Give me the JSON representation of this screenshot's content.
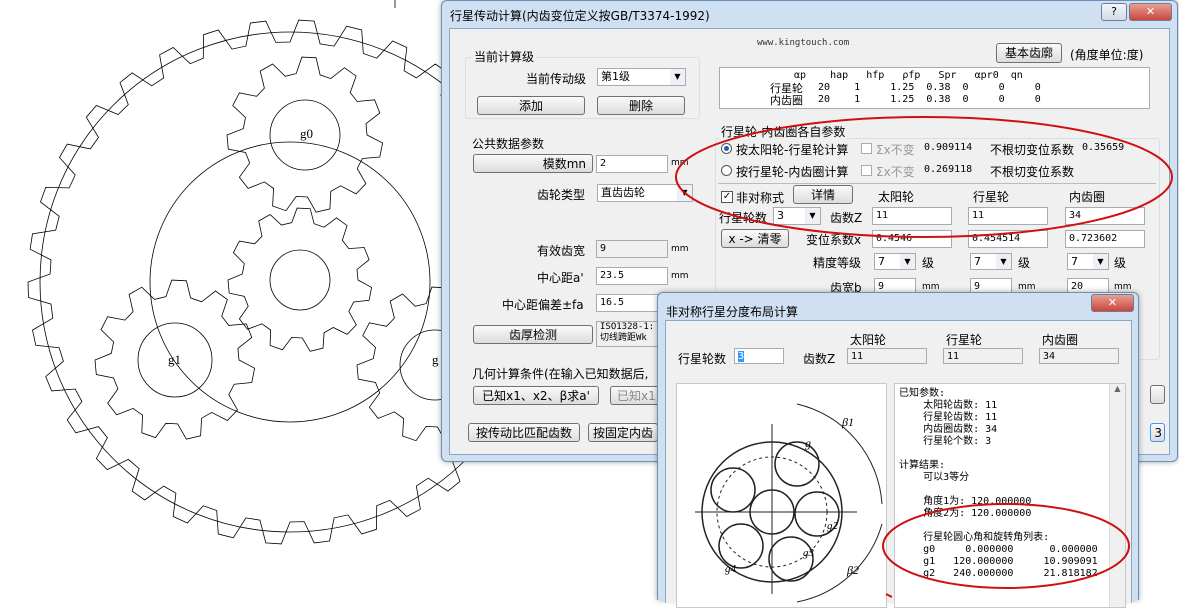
{
  "gear_drawing": {
    "labels": [
      "g0",
      "g1",
      "g"
    ]
  },
  "main_window": {
    "title": "行星传动计算(内齿变位定义按GB/T3374-1992)",
    "help_icon": "?",
    "close_icon": "✕",
    "watermark": "www.kingtouch.com",
    "basic_profile_button": "基本齿廓",
    "angle_unit": "(角度单位:度)",
    "current_stage_group": "当前计算级",
    "current_stage_label": "当前传动级",
    "current_stage_value": "第1级",
    "add_button": "添加",
    "delete_button": "删除",
    "profile_table": {
      "header": " αp    hap   hfp   ρfp   Spr   αpr0  qn",
      "row1_label": "行星轮",
      "row1": " 20    1     1.25  0.38  0     0     0",
      "row2_label": "内齿圈",
      "row2": " 20    1     1.25  0.38  0     0     0"
    },
    "common_group": "公共数据参数",
    "module_button": "模数mn",
    "module_value": "2",
    "unit_mm": "mm",
    "gear_type_label": "齿轮类型",
    "gear_type_value": "直齿齿轮",
    "face_width_label": "有效齿宽",
    "face_width_value": "9",
    "center_distance_label": "中心距a'",
    "center_distance_value": "23.5",
    "center_dev_label": "中心距偏差±fa",
    "center_dev_value": "16.5",
    "tooth_check_button": "齿厚检测",
    "tooth_check_text": "ISO1328-1:\n切线跨距Wk",
    "geometry_condition": "几何计算条件(在输入已知数据后,",
    "known_x_button": "已知x1、x2、β求a'",
    "known_x1_button": "已知x1",
    "ratio_match_button": "按传动比匹配齿数",
    "fixed_ring_button": "按固定内齿",
    "planet_ring_group": "行星轮-内齿圈各自参数",
    "radio1_label": "按太阳轮-行星轮计算",
    "radio2_label": "按行星轮-内齿圈计算",
    "sigma_label": "Σx不变",
    "sigma1_value": "0.909114",
    "sigma2_value": "0.269118",
    "no_undercut_label1": "不根切变位系数",
    "no_undercut_value1": "0.35659",
    "no_undercut_label2": "不根切变位系数",
    "asym_label": "非对称式",
    "detail_button": "详情",
    "sun_header": "太阳轮",
    "planet_header": "行星轮",
    "ring_header": "内齿圈",
    "planet_count_label": "行星轮数",
    "planet_count_value": "3",
    "teeth_label": "齿数Z",
    "sun_teeth": "11",
    "planet_teeth": "11",
    "ring_teeth": "34",
    "x_clear_button": "x -> 清零",
    "shift_label": "变位系数x",
    "sun_shift": "0.4546",
    "planet_shift": "0.454514",
    "ring_shift": "0.723602",
    "accuracy_label": "精度等级",
    "accuracy_values": [
      "7",
      "7",
      "7"
    ],
    "grade_unit": "级",
    "width_label": "齿宽b",
    "sun_width": "9",
    "planet_width": "9",
    "ring_width": "20",
    "partial_button_text": "3"
  },
  "dialog": {
    "title": "非对称行星分度布局计算",
    "close_icon": "✕",
    "planet_count_label": "行星轮数",
    "planet_count_value": "3",
    "teeth_label": "齿数Z",
    "sun_header": "太阳轮",
    "planet_header": "行星轮",
    "ring_header": "内齿圈",
    "sun_teeth": "11",
    "planet_teeth": "11",
    "ring_teeth": "34",
    "figure_labels": {
      "beta1": "β1",
      "beta2": "β2",
      "g": "g",
      "g2": "g2",
      "g3": "g3",
      "g4": "g4"
    },
    "results_text": "已知参数:\n    太阳轮齿数: 11\n    行星轮齿数: 11\n    内齿圈齿数: 34\n    行星轮个数: 3\n\n计算结果:\n    可以3等分\n\n    角度1为: 120.000000\n    角度2为: 120.000000\n\n    行星轮圆心角和旋转角列表:\n    g0     0.000000      0.000000\n    g1   120.000000     10.909091\n    g2   240.000000     21.818182"
  },
  "colors": {
    "annotation": "#d01010",
    "window_frame": "#cfe0f2",
    "close_button": "#c9463d",
    "selection": "#3399ff"
  }
}
